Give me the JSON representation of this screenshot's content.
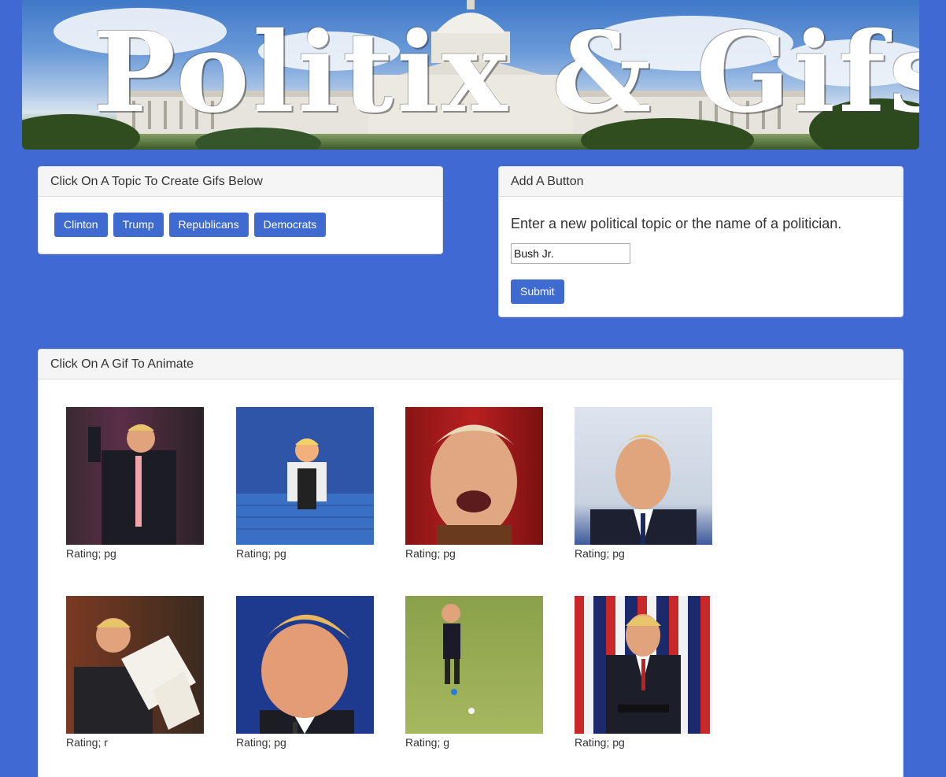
{
  "banner": {
    "title": "Politix & Gifs"
  },
  "topics_panel": {
    "heading": "Click On A Topic To Create Gifs Below",
    "buttons": [
      "Clinton",
      "Trump",
      "Republicans",
      "Democrats"
    ]
  },
  "add_panel": {
    "heading": "Add A Button",
    "prompt": "Enter a new political topic or the name of a politician.",
    "input_value": "Bush Jr.",
    "submit_label": "Submit"
  },
  "gifs_panel": {
    "heading": "Click On A Gif To Animate",
    "gifs": [
      {
        "rating": "Rating; pg"
      },
      {
        "rating": "Rating; pg"
      },
      {
        "rating": "Rating; pg"
      },
      {
        "rating": "Rating; pg"
      },
      {
        "rating": "Rating; r"
      },
      {
        "rating": "Rating; pg"
      },
      {
        "rating": "Rating; g"
      },
      {
        "rating": "Rating; pg"
      }
    ]
  },
  "colors": {
    "page_bg": "#4169d4",
    "button": "#3f6bd0",
    "panel_heading_bg": "#f5f5f5"
  }
}
